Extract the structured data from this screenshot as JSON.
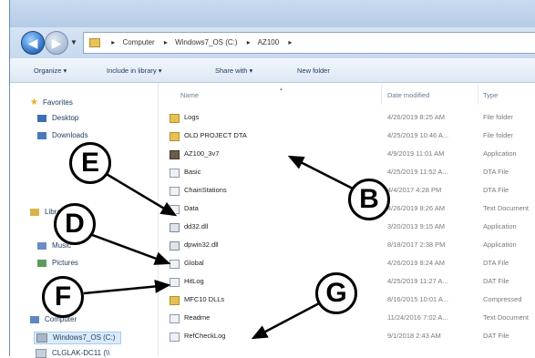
{
  "address_bar": {
    "crumbs": [
      "Computer",
      "Windows7_OS (C:)",
      "AZ100"
    ]
  },
  "toolbar": {
    "organize": "Organize ▾",
    "include_in_library": "Include in library ▾",
    "share_with": "Share with ▾",
    "new_folder": "New folder"
  },
  "nav_pane": {
    "favorites": "Favorites",
    "desktop": "Desktop",
    "downloads": "Downloads",
    "libraries": "Libraries",
    "music": "Music",
    "pictures": "Pictures",
    "computer": "Computer",
    "drive_c": "Windows7_OS (C:)",
    "drive_d": "CLGLAK-DC11 (\\\\"
  },
  "columns": {
    "name": "Name",
    "date_modified": "Date modified",
    "type": "Type"
  },
  "files": [
    {
      "name": "Logs",
      "date": "4/26/2019 8:25 AM",
      "type": "File folder",
      "icon": "folder"
    },
    {
      "name": "OLD PROJECT DTA",
      "date": "4/25/2019 10:46 A...",
      "type": "File folder",
      "icon": "folder"
    },
    {
      "name": "AZ100_3v7",
      "date": "4/9/2019 11:01 AM",
      "type": "Application",
      "icon": "app"
    },
    {
      "name": "Basic",
      "date": "4/25/2019 11:52 A...",
      "type": "DTA File",
      "icon": "file"
    },
    {
      "name": "ChainStations",
      "date": "4/4/2017 4:28 PM",
      "type": "DTA File",
      "icon": "file"
    },
    {
      "name": "Data",
      "date": "4/26/2019 8:26 AM",
      "type": "Text Document",
      "icon": "file"
    },
    {
      "name": "dd32.dll",
      "date": "3/20/2013 9:15 AM",
      "type": "Application",
      "icon": "dll"
    },
    {
      "name": "dpwin32.dll",
      "date": "8/18/2017 2:38 PM",
      "type": "Application",
      "icon": "dll"
    },
    {
      "name": "Global",
      "date": "4/26/2019 8:24 AM",
      "type": "DTA File",
      "icon": "file"
    },
    {
      "name": "HitLog",
      "date": "4/25/2019 11:27 A...",
      "type": "DAT File",
      "icon": "file"
    },
    {
      "name": "MFC10 DLLs",
      "date": "8/16/2015 10:01 A...",
      "type": "Compressed",
      "icon": "folder"
    },
    {
      "name": "Readme",
      "date": "11/24/2016 7:02 A...",
      "type": "Text Document",
      "icon": "file"
    },
    {
      "name": "RefCheckLog",
      "date": "9/1/2018 2:43 AM",
      "type": "DAT File",
      "icon": "file"
    }
  ],
  "callouts": {
    "b": "B",
    "d": "D",
    "e": "E",
    "f": "F",
    "g": "G"
  }
}
